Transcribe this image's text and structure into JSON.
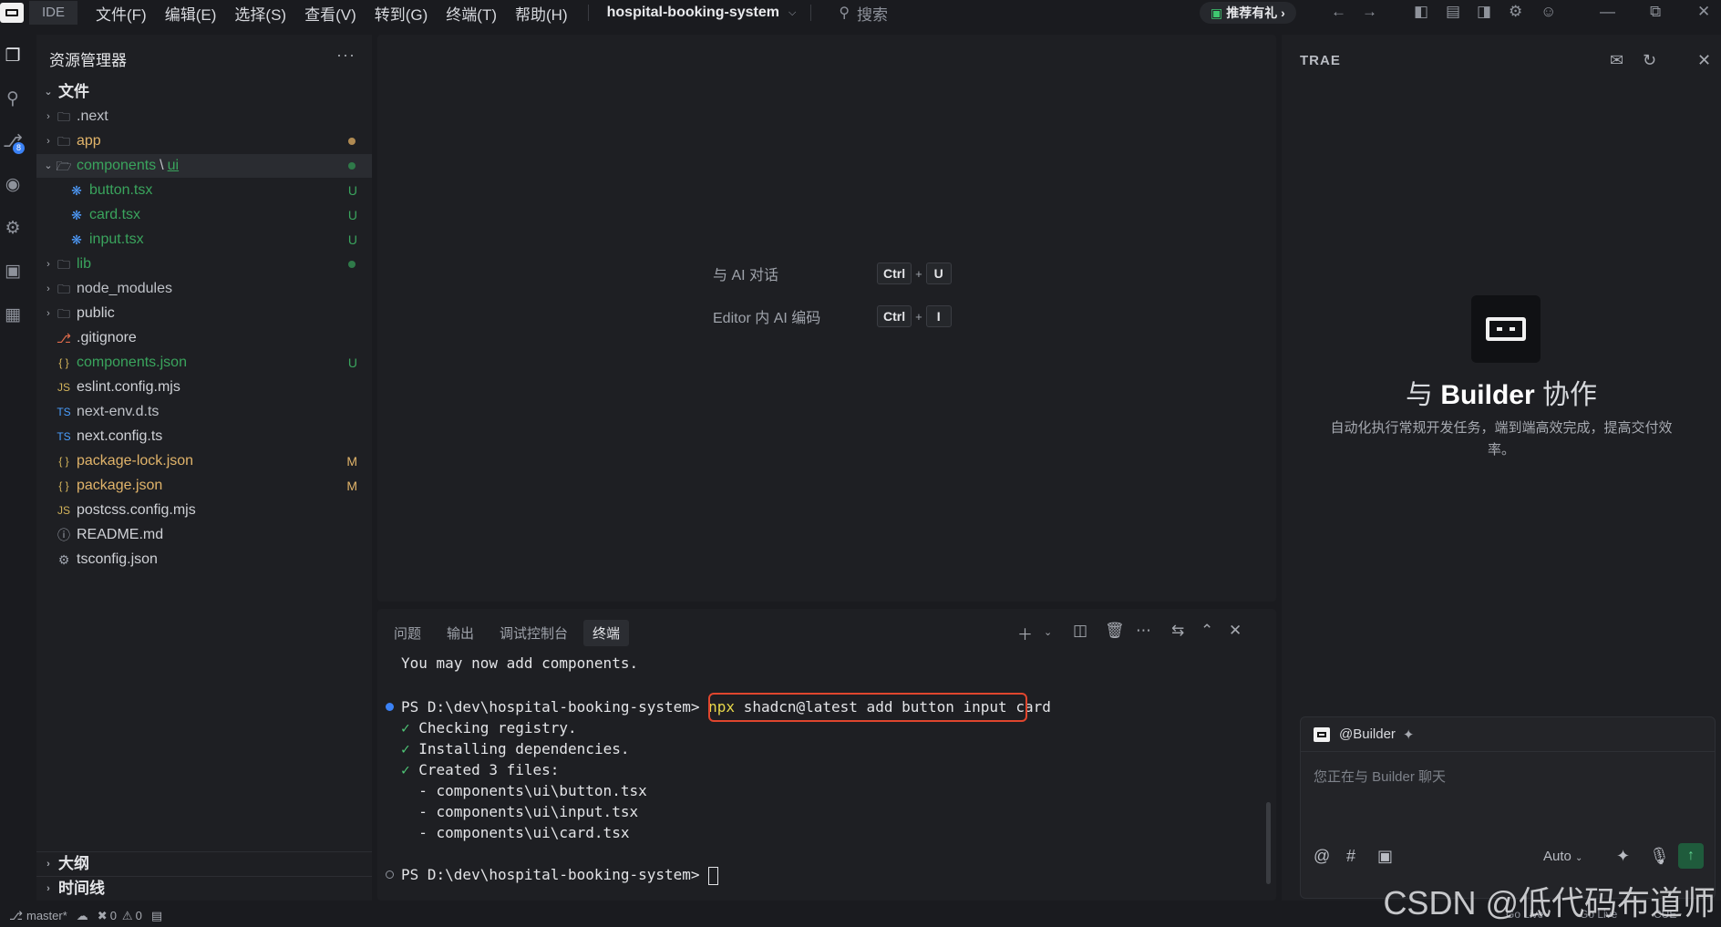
{
  "titlebar": {
    "ide_label": "IDE",
    "menus": [
      "文件(F)",
      "编辑(E)",
      "选择(S)",
      "查看(V)",
      "转到(G)",
      "终端(T)",
      "帮助(H)"
    ],
    "project": "hospital-booking-system",
    "search_placeholder": "搜索",
    "promo": "推荐有礼"
  },
  "activity": {
    "source_control_badge": "8"
  },
  "explorer": {
    "title": "资源管理器",
    "more": "···",
    "root": "文件",
    "items": [
      {
        "name": ".next",
        "suffix": "",
        "status": ""
      },
      {
        "name": "app",
        "suffix": "",
        "status": ""
      },
      {
        "name": "components",
        "suffix": "ui",
        "status": ""
      },
      {
        "name": "button.tsx",
        "suffix": "",
        "status": "U"
      },
      {
        "name": "card.tsx",
        "suffix": "",
        "status": "U"
      },
      {
        "name": "input.tsx",
        "suffix": "",
        "status": "U"
      },
      {
        "name": "lib",
        "suffix": "",
        "status": ""
      },
      {
        "name": "node_modules",
        "suffix": "",
        "status": ""
      },
      {
        "name": "public",
        "suffix": "",
        "status": ""
      },
      {
        "name": ".gitignore",
        "suffix": "",
        "status": ""
      },
      {
        "name": "components.json",
        "suffix": "",
        "status": "U"
      },
      {
        "name": "eslint.config.mjs",
        "suffix": "",
        "status": ""
      },
      {
        "name": "next-env.d.ts",
        "suffix": "",
        "status": ""
      },
      {
        "name": "next.config.ts",
        "suffix": "",
        "status": ""
      },
      {
        "name": "package-lock.json",
        "suffix": "",
        "status": "M"
      },
      {
        "name": "package.json",
        "suffix": "",
        "status": "M"
      },
      {
        "name": "postcss.config.mjs",
        "suffix": "",
        "status": ""
      },
      {
        "name": "README.md",
        "suffix": "",
        "status": ""
      },
      {
        "name": "tsconfig.json",
        "suffix": "",
        "status": ""
      }
    ],
    "icons": {
      "js": "JS",
      "ts": "TS",
      "json": "{ }"
    },
    "outline": "大纲",
    "timeline": "时间线"
  },
  "editor": {
    "hints": [
      {
        "label": "与 AI 对话",
        "keys": [
          "Ctrl",
          "U"
        ]
      },
      {
        "label": "Editor 内 AI 编码",
        "keys": [
          "Ctrl",
          "I"
        ]
      }
    ],
    "plus": "+"
  },
  "panel": {
    "tabs": [
      "问题",
      "输出",
      "调试控制台",
      "终端"
    ],
    "terminal": {
      "line1": "You may now add components.",
      "prompt": "PS D:\\dev\\hospital-booking-system>",
      "cmd_npx": "npx",
      "cmd_rest": " shadcn@latest add button input card",
      "check1": "Checking registry.",
      "check2": "Installing dependencies.",
      "check3": "Created 3 files:",
      "file1": "  - components\\ui\\button.tsx",
      "file2": "  - components\\ui\\input.tsx",
      "file3": "  - components\\ui\\card.tsx",
      "checkmark": "✓"
    }
  },
  "right": {
    "title": "TRAE",
    "collab_prefix": "与 ",
    "collab_bold": "Builder",
    "collab_suffix": " 协作",
    "desc": "自动化执行常规开发任务，端到端高效完成，提高交付效率。",
    "chat_agent": "@Builder",
    "chat_placeholder": "您正在与 Builder 聊天",
    "mode": "Auto",
    "at": "@",
    "hash": "#"
  },
  "statusbar": {
    "branch": "master*",
    "errors": "0",
    "warnings": "0",
    "golive1": "Go Live",
    "golive2": "Go Live",
    "cue": "CUE"
  },
  "watermark": "CSDN @低代码布道师",
  "colors": {
    "accent_green": "#3aa45d",
    "modified": "#e1b46a",
    "highlight_red": "#e0462e"
  }
}
